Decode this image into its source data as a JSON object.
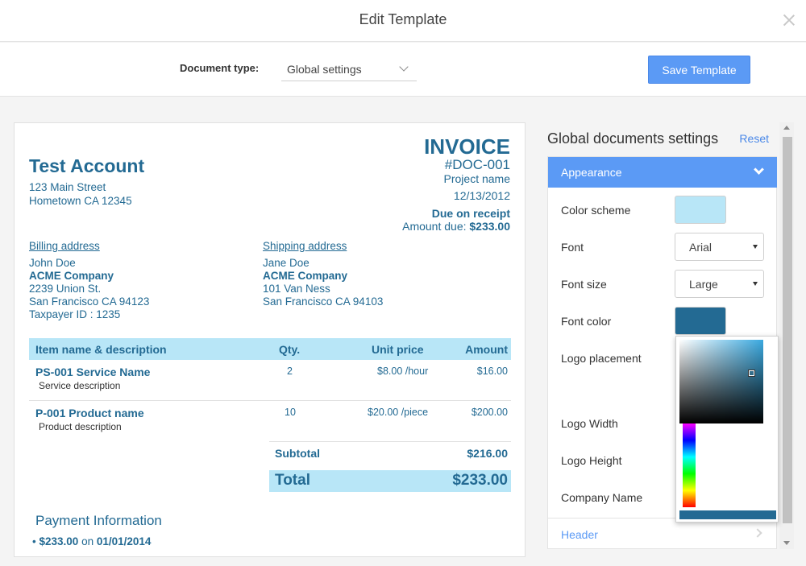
{
  "window": {
    "title": "Edit Template"
  },
  "toolbar": {
    "doc_type_label": "Document type:",
    "doc_type_value": "Global settings",
    "save_label": "Save Template"
  },
  "invoice": {
    "account_name": "Test Account",
    "address_line1": "123 Main Street",
    "address_line2": "Hometown CA 12345",
    "title": "INVOICE",
    "number": "#DOC-001",
    "project": "Project name",
    "date": "12/13/2012",
    "terms": "Due on receipt",
    "amount_due_label": "Amount due:",
    "amount_due_value": "$233.00",
    "billing": {
      "heading": "Billing address",
      "name": "John Doe",
      "company": "ACME Company",
      "street": "2239 Union St.",
      "city": "San Francisco CA 94123",
      "taxpayer": "Taxpayer ID : 1235"
    },
    "shipping": {
      "heading": "Shipping address",
      "name": "Jane Doe",
      "company": "ACME Company",
      "street": "101 Van Ness",
      "city": "San Francisco CA 94103"
    },
    "table": {
      "headers": {
        "item": "Item name & description",
        "qty": "Qty.",
        "unit": "Unit price",
        "amount": "Amount"
      },
      "rows": [
        {
          "name": "PS-001 Service Name",
          "desc": "Service description",
          "qty": "2",
          "unit": "$8.00 /hour",
          "amount": "$16.00"
        },
        {
          "name": "P-001 Product name",
          "desc": "Product description",
          "qty": "10",
          "unit": "$20.00 /piece",
          "amount": "$200.00"
        }
      ]
    },
    "subtotal_label": "Subtotal",
    "subtotal_value": "$216.00",
    "total_label": "Total",
    "total_value": "$233.00",
    "payment_title": "Payment Information",
    "payment_amount": "$233.00",
    "payment_on": "on",
    "payment_date": "01/01/2014"
  },
  "settings": {
    "title": "Global documents settings",
    "reset_label": "Reset",
    "section_appearance": "Appearance",
    "fields": {
      "color_scheme": "Color scheme",
      "font": "Font",
      "font_size": "Font size",
      "font_color": "Font color",
      "logo_placement": "Logo placement",
      "logo_width": "Logo Width",
      "logo_height": "Logo Height",
      "company_name": "Company Name"
    },
    "font_value": "Arial",
    "font_size_value": "Large",
    "section_header": "Header"
  },
  "colors": {
    "accent": "#5b9af5",
    "text_primary": "#236a93",
    "color_scheme": "#b8e6f7",
    "font_color": "#236a93"
  }
}
